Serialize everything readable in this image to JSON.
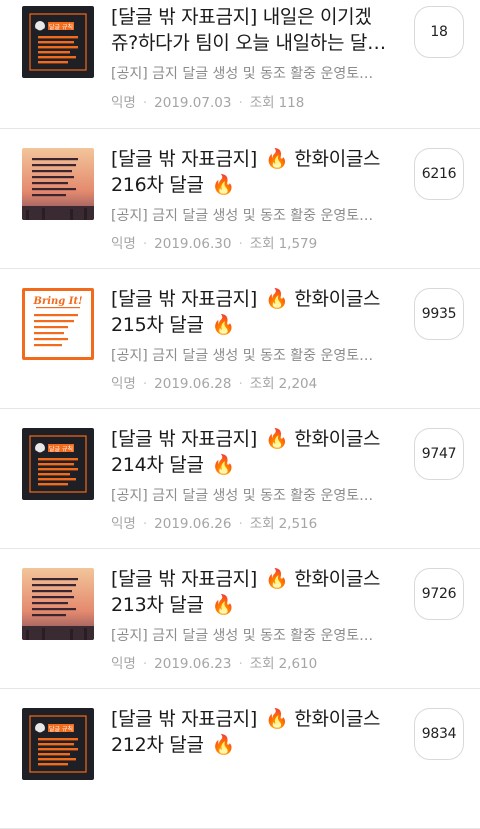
{
  "posts": [
    {
      "title_line1": "[달글 밖 자표금지] 내일은 이기겠",
      "title_line2": "쥬?하다가 팀이 오늘 내일하는 달…",
      "has_fire": false,
      "notice": "[공지] 금지 달글 생성 및 동조 활중 운영토…",
      "author": "익명",
      "date": "2019.07.03",
      "views_label": "조회",
      "views": "118",
      "comments": "18",
      "thumbnail": "dark-rules-card",
      "thumbnail_text": "달글 규칙"
    },
    {
      "title_line1": "[달글 밖 자표금지]",
      "title_suffix": "한화이글스",
      "title_line2": "216차 달글",
      "has_fire": true,
      "notice": "[공지] 금지 달글 생성 및 동조 활중 운영토…",
      "author": "익명",
      "date": "2019.06.30",
      "views_label": "조회",
      "views": "1,579",
      "comments": "6216",
      "thumbnail": "stadium-rules-card"
    },
    {
      "title_line1": "[달글 밖 자표금지]",
      "title_suffix": "한화이글스",
      "title_line2": "215차 달글",
      "has_fire": true,
      "notice": "[공지] 금지 달글 생성 및 동조 활중 운영토…",
      "author": "익명",
      "date": "2019.06.28",
      "views_label": "조회",
      "views": "2,204",
      "comments": "9935",
      "thumbnail": "bring-it-card",
      "thumbnail_text": "Bring It!"
    },
    {
      "title_line1": "[달글 밖 자표금지]",
      "title_suffix": "한화이글스",
      "title_line2": "214차 달글",
      "has_fire": true,
      "notice": "[공지] 금지 달글 생성 및 동조 활중 운영토…",
      "author": "익명",
      "date": "2019.06.26",
      "views_label": "조회",
      "views": "2,516",
      "comments": "9747",
      "thumbnail": "dark-rules-card",
      "thumbnail_text": "달글 규칙"
    },
    {
      "title_line1": "[달글 밖 자표금지]",
      "title_suffix": "한화이글스",
      "title_line2": "213차 달글",
      "has_fire": true,
      "notice": "[공지] 금지 달글 생성 및 동조 활중 운영토…",
      "author": "익명",
      "date": "2019.06.23",
      "views_label": "조회",
      "views": "2,610",
      "comments": "9726",
      "thumbnail": "stadium-rules-card"
    },
    {
      "title_line1": "[달글 밖 자표금지]",
      "title_suffix": "한화이글스",
      "title_line2": "212차 달글",
      "has_fire": true,
      "notice": "",
      "author": "",
      "date": "",
      "views_label": "",
      "views": "",
      "comments": "9834",
      "thumbnail": "dark-rules-card",
      "thumbnail_text": "달글 규칙"
    }
  ],
  "fire_glyph": "🔥",
  "meta_separator": "·",
  "colors": {
    "accent_orange": "#f26a1b",
    "meta_gray": "#a5a5a5",
    "notice_gray": "#8c8c8c",
    "dark_card": "#1f1f26"
  }
}
